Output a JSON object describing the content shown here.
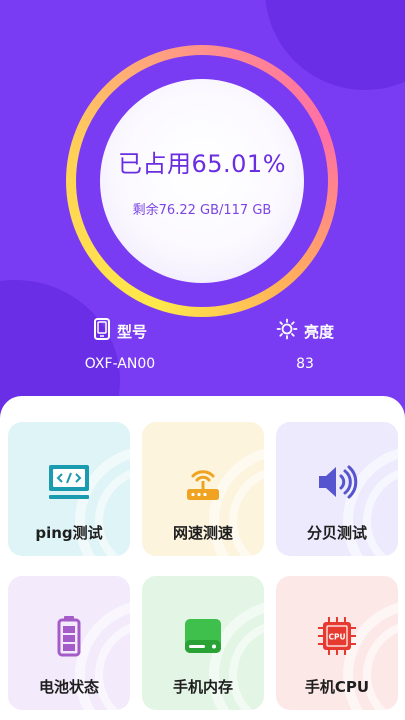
{
  "storage": {
    "used_label": "已占用65.01%",
    "remaining_label": "剩余76.22 GB/117 GB",
    "used_percent": 65.01
  },
  "device": {
    "model_label": "型号",
    "model_value": "OXF-AN00",
    "brightness_label": "亮度",
    "brightness_value": "83"
  },
  "tools": [
    {
      "label": "ping测试",
      "icon": "code-icon"
    },
    {
      "label": "网速测速",
      "icon": "router-icon"
    },
    {
      "label": "分贝测试",
      "icon": "speaker-icon"
    },
    {
      "label": "电池状态",
      "icon": "battery-icon"
    },
    {
      "label": "手机内存",
      "icon": "storage-icon"
    },
    {
      "label": "手机CPU",
      "icon": "cpu-icon"
    }
  ],
  "colors": {
    "hero": "#7a3cf2",
    "accent": "#6a2de0"
  }
}
